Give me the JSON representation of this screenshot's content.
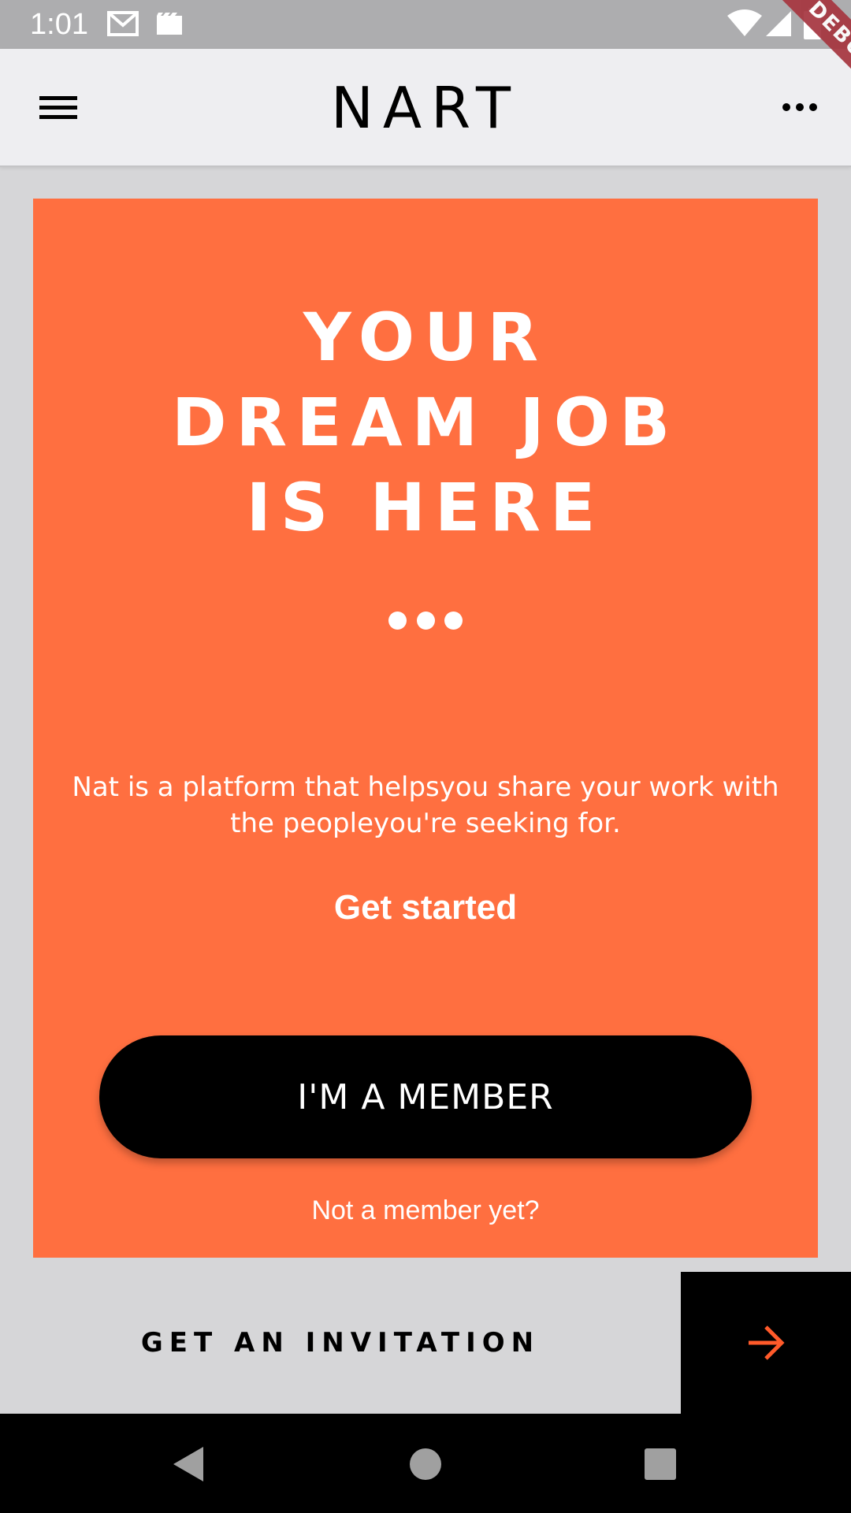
{
  "status_bar": {
    "time": "1:01",
    "icons": [
      "gmail-icon",
      "clapper-icon",
      "wifi-icon",
      "cellular-signal-icon",
      "battery-icon"
    ]
  },
  "app_bar": {
    "title": "NART",
    "menu_icon": "hamburger-menu-icon",
    "more_icon": "more-horizontal-icon"
  },
  "debug_banner": "DEBUG",
  "hero": {
    "headline_lines": [
      "YOUR",
      "DREAM JOB",
      "IS HERE"
    ],
    "page_indicator_count": 3,
    "description": "Nat is a platform that helpsyou share your work with the peopleyou're seeking for.",
    "get_started_label": "Get started",
    "member_button_label": "I'M A MEMBER",
    "not_member_label": "Not a member yet?"
  },
  "invitation": {
    "label": "GET AN INVITATION",
    "arrow_icon": "arrow-right-icon"
  },
  "nav_bar": {
    "buttons": [
      "back-icon",
      "home-icon",
      "recents-icon"
    ]
  },
  "colors": {
    "accent": "#ff6f40",
    "app_bar_bg": "#eeeef1",
    "page_bg": "#d6d6d8",
    "status_bar_bg": "#adadaf",
    "arrow": "#ff5a2a",
    "debug_banner": "#a6353f"
  }
}
